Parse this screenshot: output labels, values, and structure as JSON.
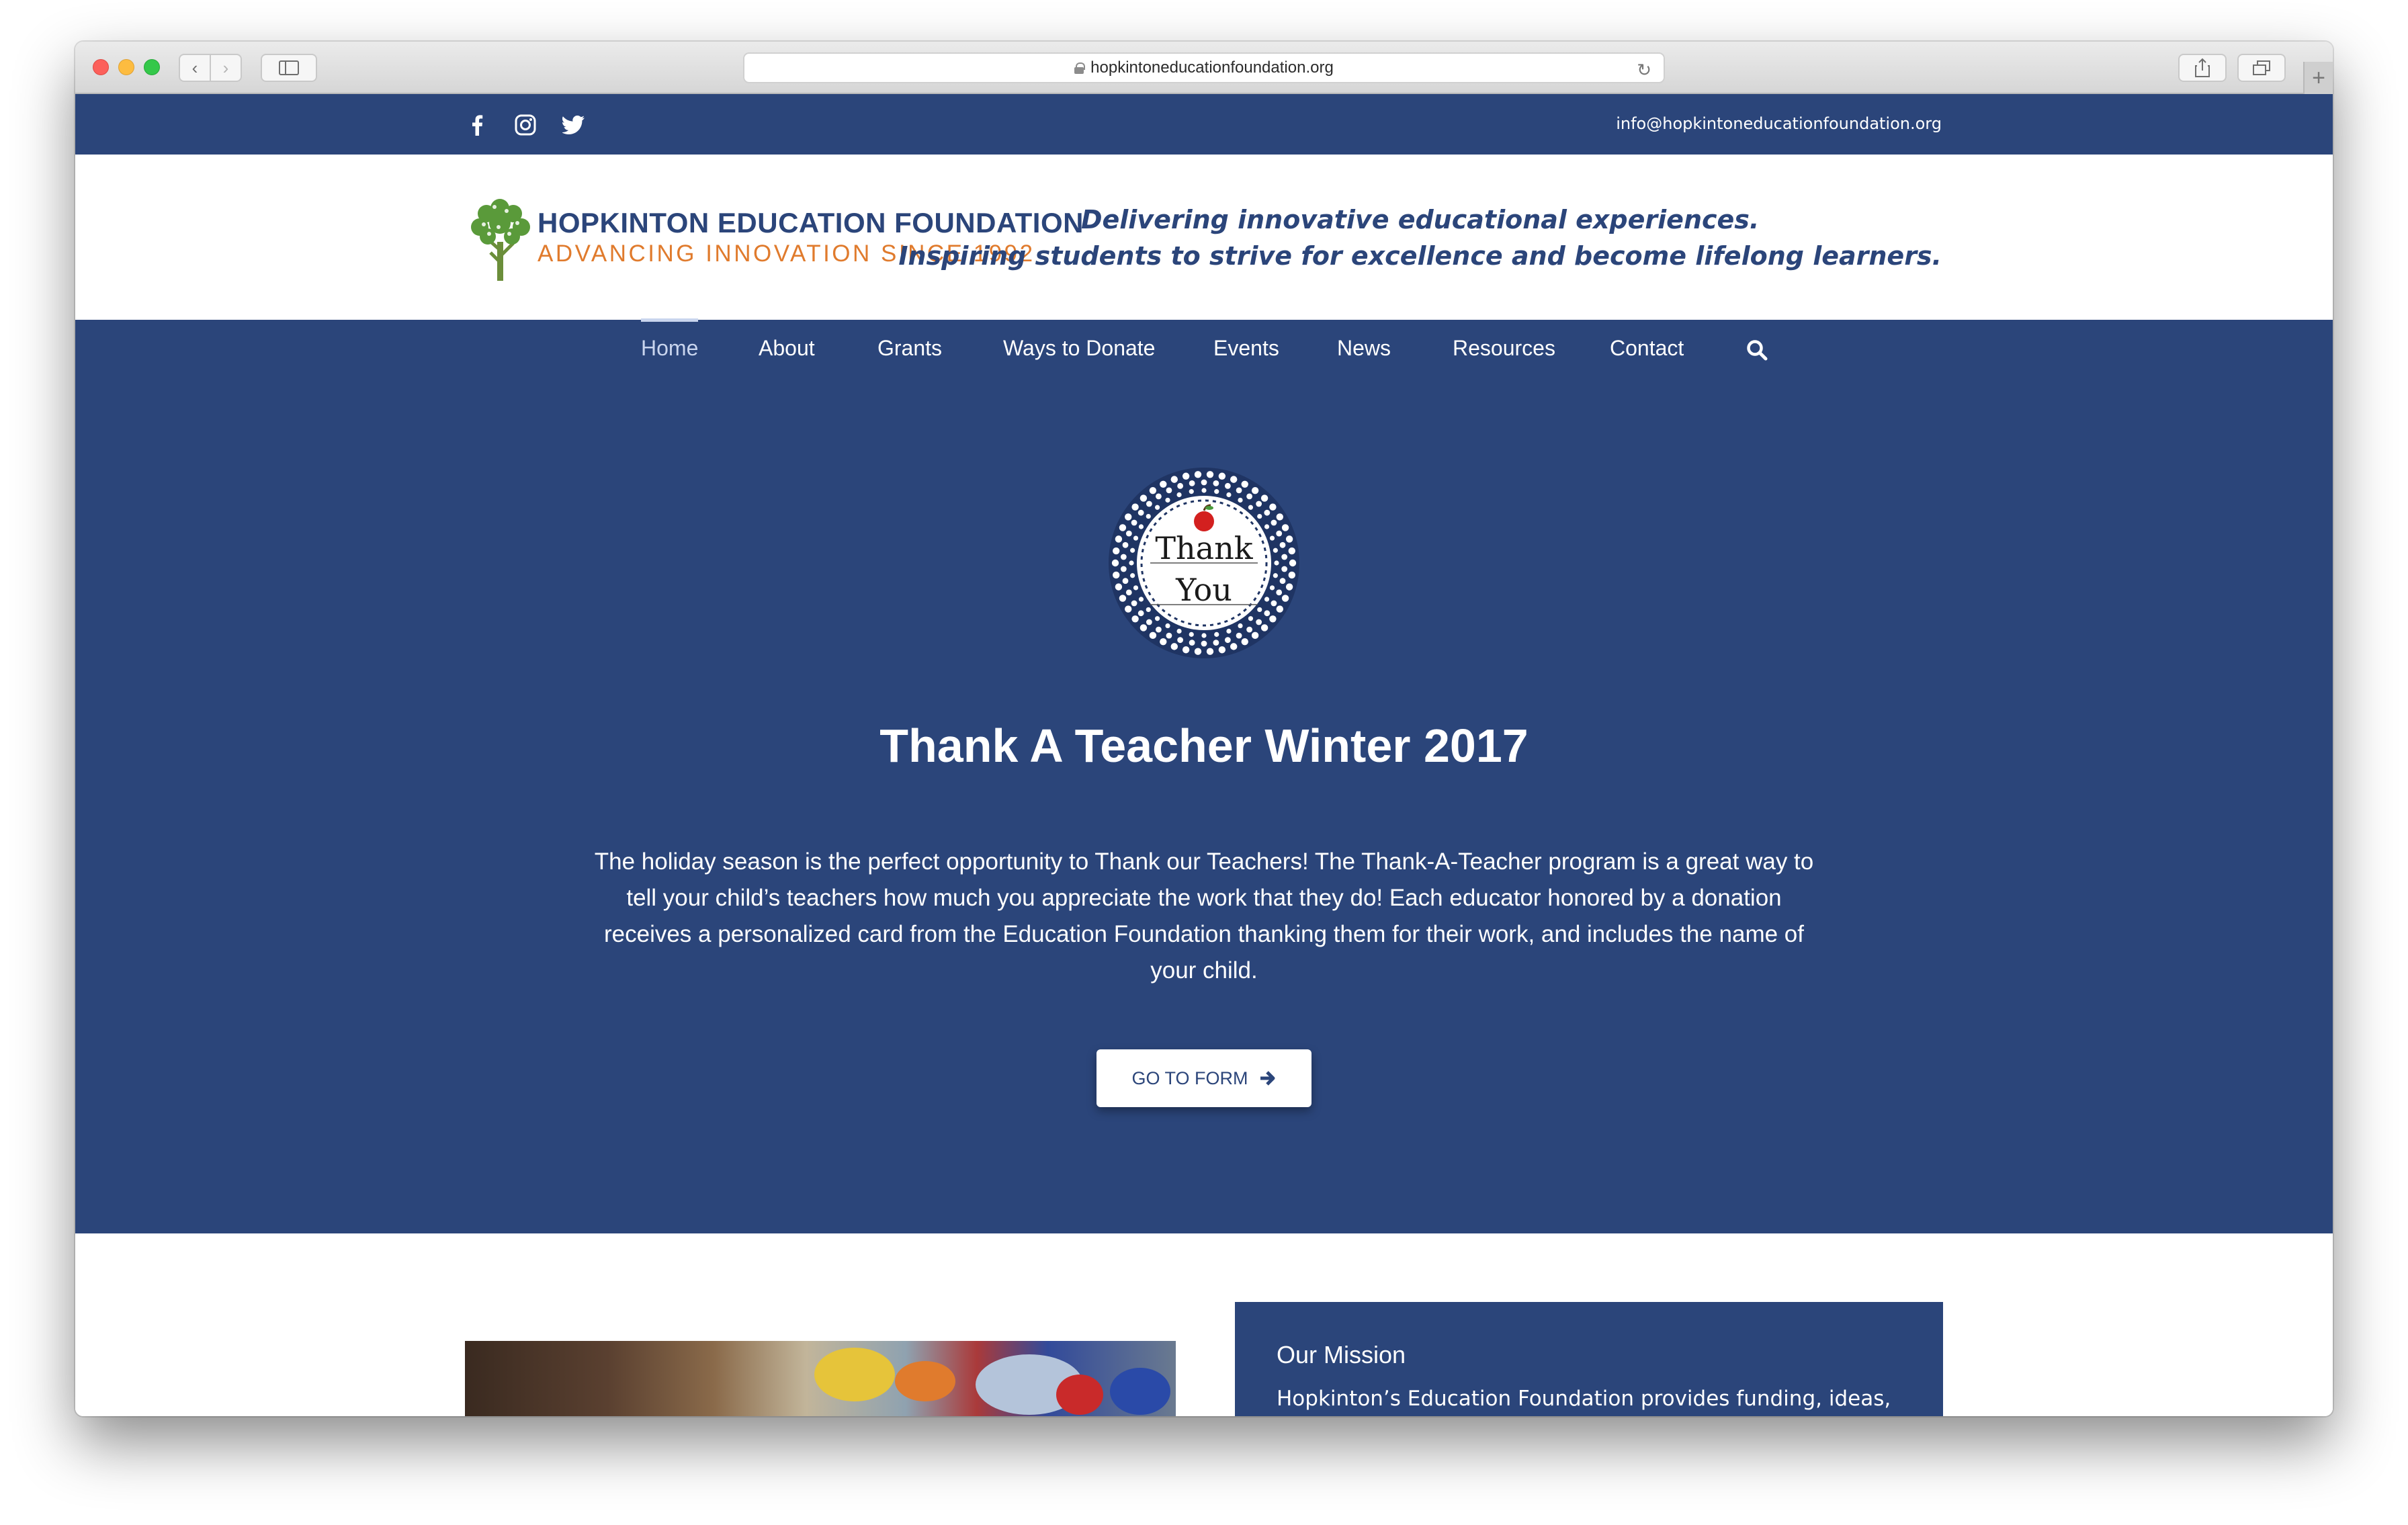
{
  "browser": {
    "url": "hopkintoneducationfoundation.org"
  },
  "topbar": {
    "social_icons": [
      "facebook-icon",
      "instagram-icon",
      "twitter-icon"
    ],
    "email": "info@hopkintoneducationfoundation.org"
  },
  "header": {
    "logo_line1": "HOPKINTON EDUCATION FOUNDATION",
    "logo_line2": "ADVANCING INNOVATION SINCE 1992",
    "tagline_line1": "Delivering innovative educational experiences.",
    "tagline_line2": "Inspiring students to strive for excellence and become lifelong learners."
  },
  "nav": {
    "items": [
      {
        "label": "Home",
        "active": true
      },
      {
        "label": "About"
      },
      {
        "label": "Grants"
      },
      {
        "label": "Ways to Donate"
      },
      {
        "label": "Events"
      },
      {
        "label": "News"
      },
      {
        "label": "Resources"
      },
      {
        "label": "Contact"
      }
    ]
  },
  "hero": {
    "badge_line1": "Thank",
    "badge_line2": "You",
    "title": "Thank A Teacher Winter 2017",
    "body": "The holiday season is the perfect opportunity to Thank our Teachers! The Thank-A-Teacher program is a great way to tell your child’s teachers how much you appreciate the work that they do! Each educator honored by a donation receives a personalized card from the Education Foundation thanking them for their work, and includes the name of your child.",
    "cta_label": "GO TO FORM"
  },
  "mission": {
    "title": "Our Mission",
    "text": "Hopkinton’s Education Foundation provides funding, ideas,"
  },
  "colors": {
    "brand_blue": "#2b457a",
    "logo_orange": "#e07b2d",
    "logo_green": "#5a9a3a",
    "apple_red": "#d3201f"
  }
}
